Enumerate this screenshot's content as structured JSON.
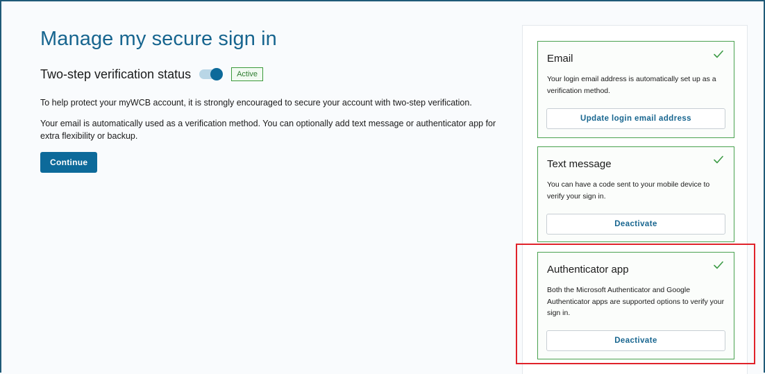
{
  "page": {
    "title": "Manage my secure sign in",
    "status_label": "Two-step verification status",
    "status_toggle_on": true,
    "status_badge": "Active",
    "paragraph_1": "To help protect your myWCB account, it is strongly encouraged to secure your account with two-step verification.",
    "paragraph_2": "Your email is automatically used as a verification method. You can optionally add text message or authenticator app for extra flexibility or backup.",
    "continue_label": "Continue"
  },
  "methods": [
    {
      "title": "Email",
      "description": "Your login email address is automatically set up as a verification method.",
      "button_label": "Update login email address",
      "enabled": true
    },
    {
      "title": "Text message",
      "description": "You can have a code sent to your mobile device to verify your sign in.",
      "button_label": "Deactivate",
      "enabled": true
    },
    {
      "title": "Authenticator app",
      "description": "Both the Microsoft Authenticator and Google Authenticator apps are supported options to verify your sign in.",
      "button_label": "Deactivate",
      "enabled": true
    }
  ],
  "colors": {
    "primary": "#0d6a9a",
    "title": "#17658f",
    "success": "#49a14f",
    "highlight": "#e0222a"
  }
}
